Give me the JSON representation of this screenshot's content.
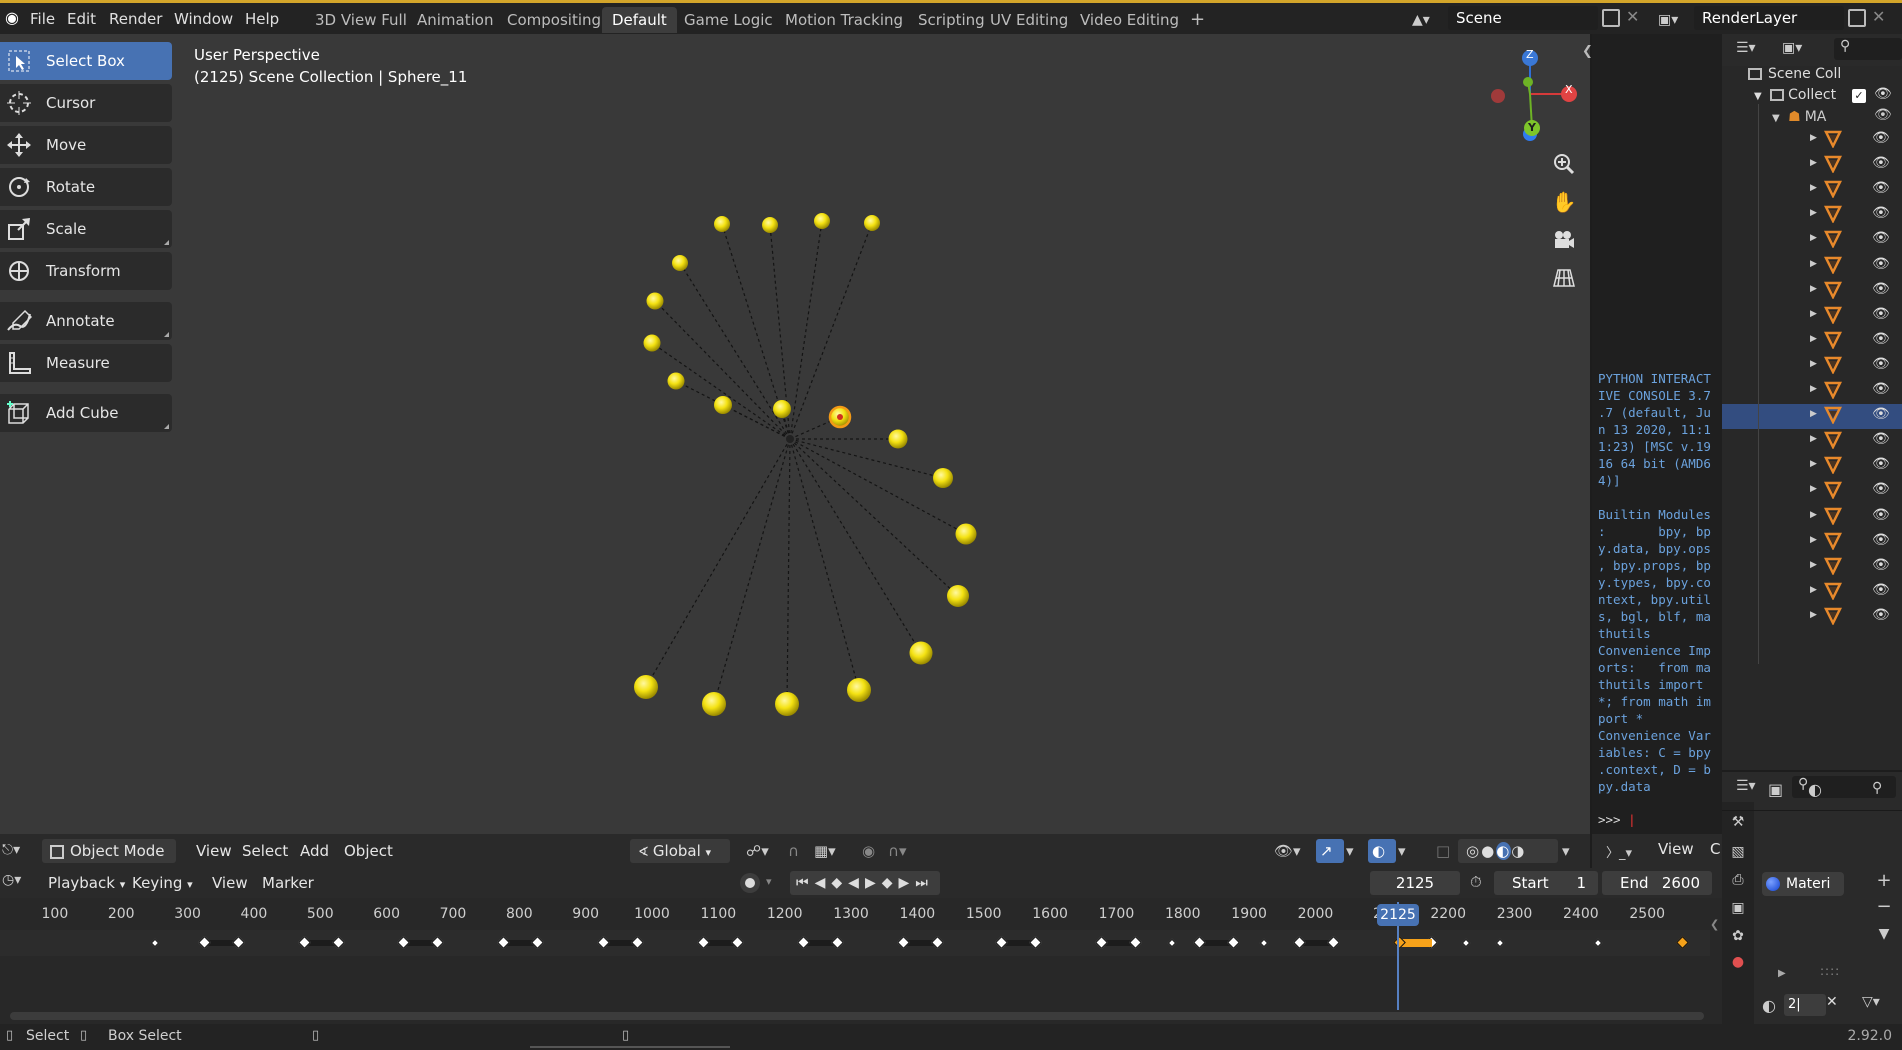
{
  "top_menu": [
    "File",
    "Edit",
    "Render",
    "Window",
    "Help"
  ],
  "workspace_tabs": [
    {
      "label": "3D View Full",
      "active": false
    },
    {
      "label": "Animation",
      "active": false
    },
    {
      "label": "Compositing",
      "active": false
    },
    {
      "label": "Default",
      "active": true
    },
    {
      "label": "Game Logic",
      "active": false
    },
    {
      "label": "Motion Tracking",
      "active": false
    },
    {
      "label": "Scripting",
      "active": false
    },
    {
      "label": "UV Editing",
      "active": false
    },
    {
      "label": "Video Editing",
      "active": false
    }
  ],
  "add_workspace": "+",
  "scene_name": "Scene",
  "view_layer_name": "RenderLayer",
  "toolbar": [
    {
      "label": "Select Box",
      "icon": "select-box-icon",
      "active": true
    },
    {
      "label": "Cursor",
      "icon": "cursor-icon",
      "active": false
    },
    {
      "label": "Move",
      "icon": "move-icon",
      "active": false
    },
    {
      "label": "Rotate",
      "icon": "rotate-icon",
      "active": false
    },
    {
      "label": "Scale",
      "icon": "scale-icon",
      "active": false
    },
    {
      "label": "Transform",
      "icon": "transform-icon",
      "active": false
    },
    {
      "label": "Annotate",
      "icon": "annotate-icon",
      "active": false
    },
    {
      "label": "Measure",
      "icon": "measure-icon",
      "active": false
    },
    {
      "label": "Add Cube",
      "icon": "add-cube-icon",
      "active": false
    }
  ],
  "viewport": {
    "view_name": "User Perspective",
    "context": "(2125) Scene Collection | Sphere_11",
    "gizmo": {
      "x": "X",
      "y": "Y",
      "z": "Z"
    }
  },
  "viewport_header": {
    "mode": "Object Mode",
    "menus": [
      "View",
      "Select",
      "Add",
      "Object"
    ],
    "orientation": "Global"
  },
  "console": {
    "text": "PYTHON INTERACT\nIVE CONSOLE 3.7\n.7 (default, Ju\nn 13 2020, 11:1\n1:23) [MSC v.19\n16 64 bit (AMD6\n4)]\n\nBuiltin Modules\n:       bpy, bp\ny.data, bpy.ops\n, bpy.props, bp\ny.types, bpy.co\nntext, bpy.util\ns, bgl, blf, ma\nthutils\nConvenience Imp\norts:   from ma\nthutils import\n*; from math im\nport *\nConvenience Var\niables: C = bpy\n.context, D = b\npy.data",
    "prompt": ">>> ",
    "header_view": "View",
    "header_extra": "C"
  },
  "outliner": {
    "scene_collection": "Scene Coll",
    "collection": "Collect",
    "armature": "MА",
    "mesh_rows": 20,
    "selected_index": 11
  },
  "properties": {
    "material_label": "Materi",
    "bottom_field": "2|"
  },
  "timeline": {
    "menus": [
      "Playback",
      "Keying",
      "View",
      "Marker"
    ],
    "current_frame": "2125",
    "start_label": "Start",
    "start": "1",
    "end_label": "End",
    "end": "2600",
    "ticks": [
      "100",
      "200",
      "300",
      "400",
      "500",
      "600",
      "700",
      "800",
      "900",
      "1000",
      "1100",
      "1200",
      "1300",
      "1400",
      "1500",
      "1600",
      "1700",
      "1800",
      "1900",
      "2000",
      "21",
      "2200",
      "2300",
      "2400",
      "2500"
    ],
    "playhead_label": "2125"
  },
  "status": {
    "select": "Select",
    "box_select": "Box Select",
    "version": "2.92.0"
  }
}
